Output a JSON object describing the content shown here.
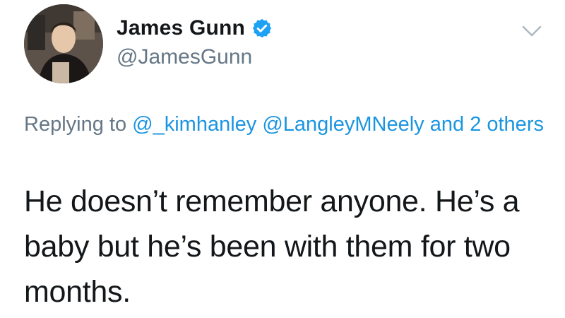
{
  "author": {
    "display_name": "James Gunn",
    "handle": "@JamesGunn",
    "verified": true,
    "avatar_icon": "profile-photo"
  },
  "reply_context": {
    "prefix": "Replying to",
    "mentions": [
      "@_kimhanley",
      "@LangleyMNeely"
    ],
    "joiner": "and",
    "others": "2 others"
  },
  "tweet": {
    "text": "He doesn’t remember anyone. He’s a baby but he’s been with them for two months."
  },
  "icons": {
    "verified": "verified-badge-icon",
    "menu": "chevron-down-icon"
  },
  "colors": {
    "link": "#1b95e0",
    "secondary_text": "#657786",
    "primary_text": "#14171a",
    "verified": "#1da1f2",
    "chevron": "#aab8c2"
  }
}
